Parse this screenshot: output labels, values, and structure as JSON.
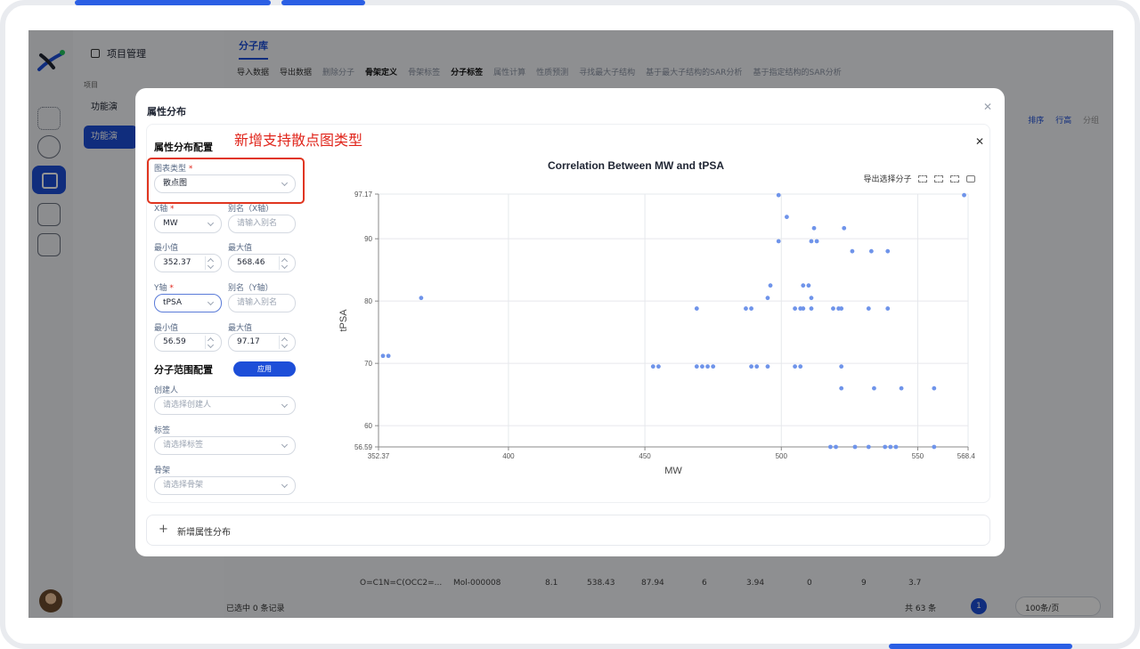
{
  "app": {
    "nav_title": "项目管理",
    "nav_section": "项目",
    "nav_items": [
      "功能演",
      "功能演"
    ],
    "main_tab": "分子库",
    "toolbar": [
      {
        "label": "导入数据",
        "style": "normal"
      },
      {
        "label": "导出数据",
        "style": "normal"
      },
      {
        "label": "删除分子",
        "style": "dim"
      },
      {
        "label": "骨架定义",
        "style": "bold"
      },
      {
        "label": "骨架标签",
        "style": "dim"
      },
      {
        "label": "分子标签",
        "style": "bold"
      },
      {
        "label": "属性计算",
        "style": "dim"
      },
      {
        "label": "性质预测",
        "style": "dim"
      },
      {
        "label": "寻找最大子结构",
        "style": "dim"
      },
      {
        "label": "基于最大子结构的SAR分析",
        "style": "dim"
      },
      {
        "label": "基于指定结构的SAR分析",
        "style": "dim"
      }
    ],
    "right_tools": [
      "排序",
      "行高",
      "分组"
    ],
    "row": {
      "smiles": "O=C1N=C(OCC2=...",
      "id": "Mol-000008",
      "v1": "8.1",
      "v2": "538.43",
      "v3": "87.94",
      "v4": "6",
      "v5": "3.94",
      "v6": "0",
      "v7": "9",
      "v8": "3.7"
    },
    "selection": "已选中 0 条记录",
    "total": "共 63 条",
    "page": "1",
    "page_size": "100条/页"
  },
  "modal": {
    "title": "属性分布",
    "config_title": "属性分布配置",
    "annotation": "新增支持散点图类型",
    "chart_type_label": "图表类型",
    "chart_type_value": "散点图",
    "x_axis_label": "X轴",
    "x_axis_value": "MW",
    "x_alias_label": "别名（X轴）",
    "y_axis_label": "Y轴",
    "y_axis_value": "tPSA",
    "y_alias_label": "别名（Y轴）",
    "alias_placeholder": "请输入别名",
    "min_label": "最小值",
    "max_label": "最大值",
    "x_min": "352.37",
    "x_max": "568.46",
    "y_min": "56.59",
    "y_max": "97.17",
    "range_title": "分子范围配置",
    "apply": "应用",
    "creator_label": "创建人",
    "creator_placeholder": "请选择创建人",
    "tag_label": "标签",
    "tag_placeholder": "请选择标签",
    "scaffold_label": "骨架",
    "scaffold_placeholder": "请选择骨架",
    "export_selected": "导出选择分子",
    "add_distribution": "新增属性分布"
  },
  "colors": {
    "accent": "#1d4ed8",
    "point": "#6f94ea",
    "annotation": "#e0251b"
  },
  "chart_data": {
    "type": "scatter",
    "title": "Correlation Between MW and tPSA",
    "xlabel": "MW",
    "ylabel": "tPSA",
    "xlim": [
      352.37,
      568.46
    ],
    "ylim": [
      56.59,
      97.17
    ],
    "xticks": [
      352.37,
      400,
      450,
      500,
      550,
      568.46
    ],
    "yticks": [
      56.59,
      60,
      70,
      80,
      90,
      97.17
    ],
    "grid": true,
    "points": [
      [
        354,
        71.2
      ],
      [
        356,
        71.2
      ],
      [
        368,
        80.5
      ],
      [
        453,
        69.5
      ],
      [
        455,
        69.5
      ],
      [
        469,
        78.8
      ],
      [
        469,
        69.5
      ],
      [
        471,
        69.5
      ],
      [
        473,
        69.5
      ],
      [
        475,
        69.5
      ],
      [
        487,
        78.8
      ],
      [
        489,
        78.8
      ],
      [
        489,
        69.5
      ],
      [
        491,
        69.5
      ],
      [
        495,
        69.5
      ],
      [
        495,
        80.5
      ],
      [
        496,
        82.5
      ],
      [
        499,
        89.6
      ],
      [
        499,
        97.0
      ],
      [
        502,
        93.5
      ],
      [
        505,
        78.8
      ],
      [
        505,
        69.5
      ],
      [
        507,
        78.8
      ],
      [
        507,
        69.5
      ],
      [
        508,
        78.8
      ],
      [
        508,
        82.5
      ],
      [
        510,
        82.5
      ],
      [
        511,
        78.8
      ],
      [
        511,
        80.5
      ],
      [
        511,
        89.6
      ],
      [
        512,
        91.7
      ],
      [
        513,
        89.6
      ],
      [
        518,
        56.59
      ],
      [
        519,
        78.8
      ],
      [
        520,
        56.59
      ],
      [
        521,
        78.8
      ],
      [
        522,
        66.0
      ],
      [
        522,
        69.5
      ],
      [
        522,
        78.8
      ],
      [
        523,
        91.7
      ],
      [
        526,
        88.0
      ],
      [
        527,
        56.59
      ],
      [
        532,
        78.8
      ],
      [
        532,
        56.59
      ],
      [
        533,
        88.0
      ],
      [
        534,
        66.0
      ],
      [
        538,
        56.59
      ],
      [
        539,
        88.0
      ],
      [
        539,
        78.8
      ],
      [
        540,
        56.59
      ],
      [
        542,
        56.59
      ],
      [
        544,
        66.0
      ],
      [
        556,
        66.0
      ],
      [
        556,
        56.59
      ],
      [
        567,
        97.0
      ]
    ]
  }
}
